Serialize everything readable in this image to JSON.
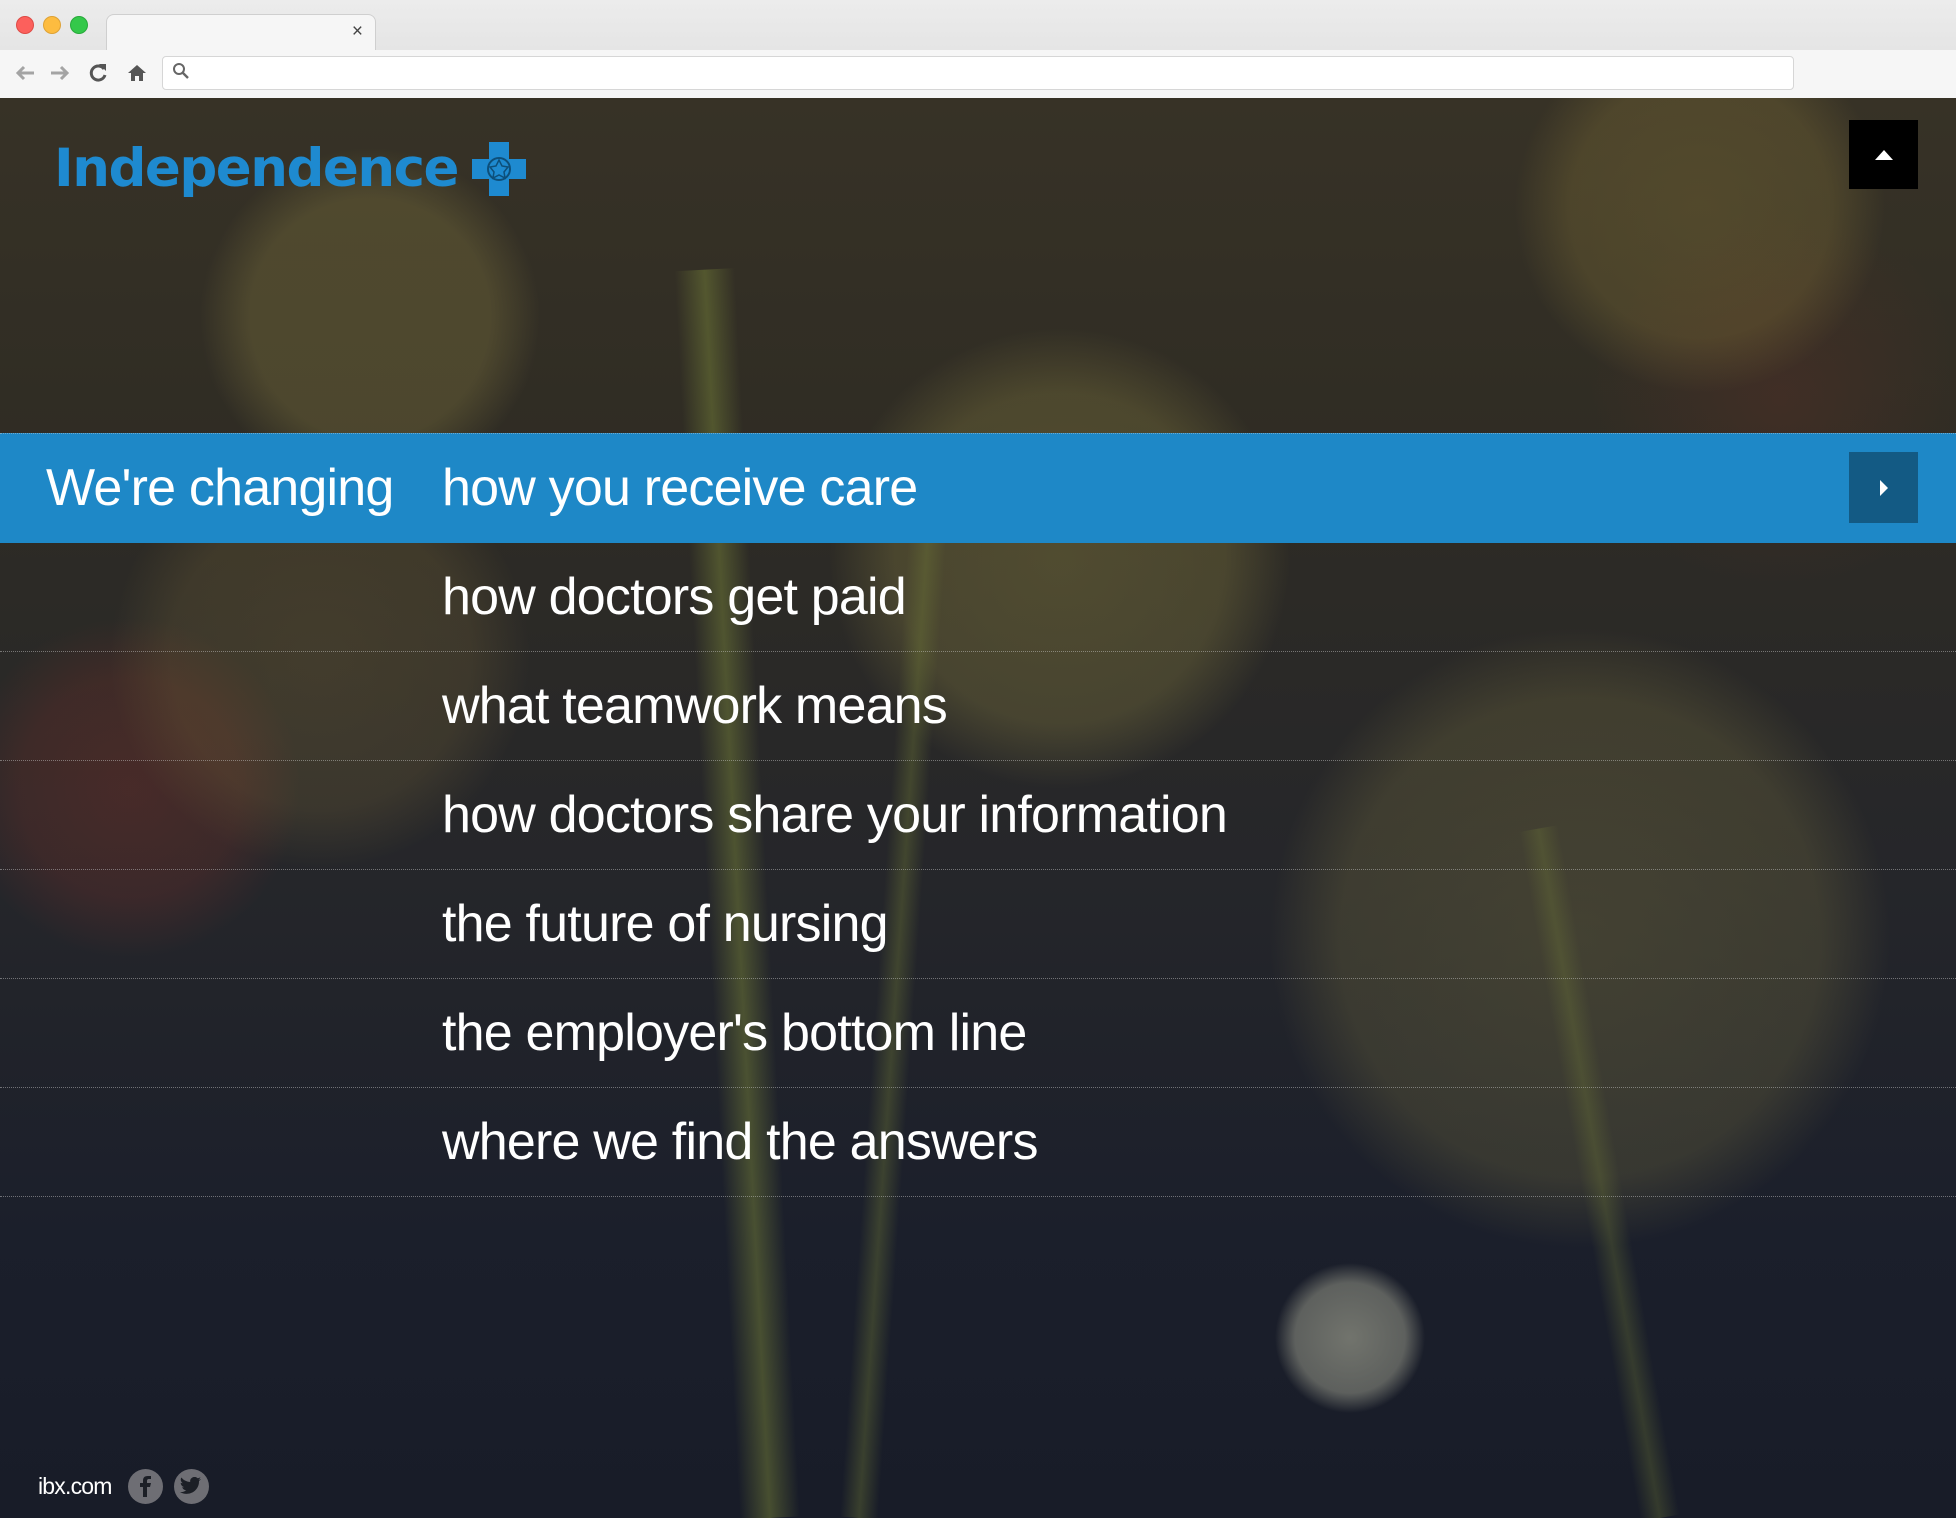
{
  "browser": {
    "tab_close": "×",
    "url_value": "",
    "icons": [
      "back-arrow-icon",
      "forward-arrow-icon",
      "reload-icon",
      "home-icon",
      "search-icon"
    ]
  },
  "brand": {
    "logo_text": "Independence",
    "logo_color": "#1e8ad0"
  },
  "menu": {
    "lead": "We're changing",
    "items": [
      "how you receive care",
      "how doctors get paid",
      "what teamwork means",
      "how doctors share your information",
      "the future of nursing",
      "the employer's bottom line",
      "where we find the answers"
    ],
    "active_index": 0,
    "active_color": "#1e88c7"
  },
  "footer": {
    "link": "ibx.com",
    "social": [
      "facebook-icon",
      "twitter-icon"
    ]
  }
}
